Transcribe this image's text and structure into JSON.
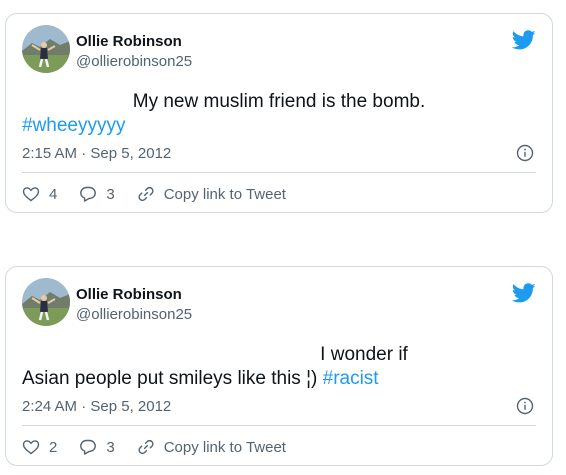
{
  "tweets": [
    {
      "author_name": "Ollie Robinson",
      "author_handle": "@ollierobinson25",
      "text_line1": "My new muslim friend is the bomb.",
      "hashtag": "#wheeyyyyy",
      "timestamp": "2:15 AM · Sep 5, 2012",
      "likes": "4",
      "replies": "3",
      "copy_label": "Copy link to Tweet"
    },
    {
      "author_name": "Ollie Robinson",
      "author_handle": "@ollierobinson25",
      "text_line1": "I wonder if",
      "text_line2": "Asian people put smileys like this ¦) ",
      "hashtag": "#racist",
      "timestamp": "2:24 AM · Sep 5, 2012",
      "likes": "2",
      "replies": "3",
      "copy_label": "Copy link to Tweet"
    }
  ],
  "icons": {
    "brand": "twitter-bird-icon",
    "info": "info-icon",
    "like": "heart-icon",
    "reply": "reply-bubble-icon",
    "copy": "link-icon"
  },
  "colors": {
    "accent": "#1d9bf0",
    "secondary_text": "#536471",
    "border": "#cfd9de"
  }
}
